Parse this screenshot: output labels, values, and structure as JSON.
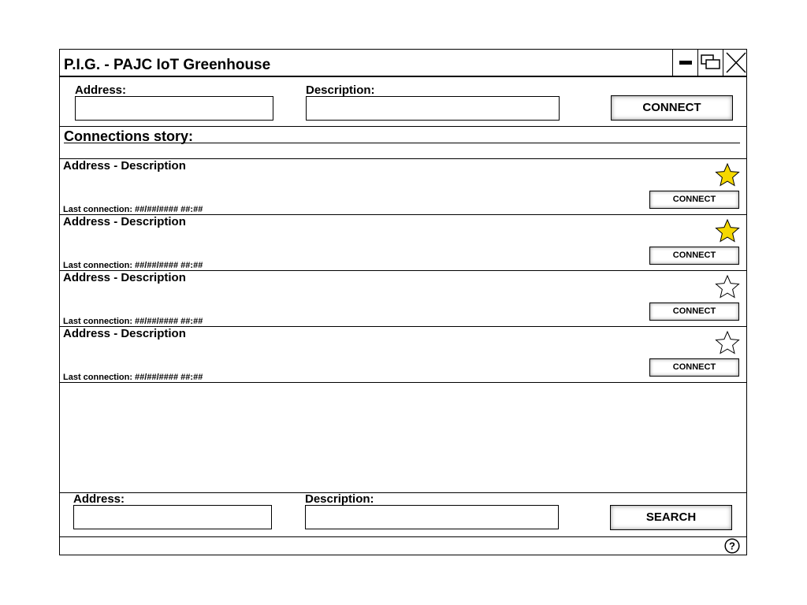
{
  "window": {
    "title": "P.I.G. - PAJC IoT Greenhouse",
    "controls": [
      "minimize-icon",
      "restore-icon",
      "close-icon"
    ]
  },
  "connect_form": {
    "address_label": "Address:",
    "address_value": "",
    "description_label": "Description:",
    "description_value": "",
    "connect_label": "CONNECT"
  },
  "story": {
    "title": "Connections story:",
    "rows": [
      {
        "title": "Address - Description",
        "last": "Last connection: ##/##/#### ##:##",
        "starred": true,
        "button": "CONNECT"
      },
      {
        "title": "Address - Description",
        "last": "Last connection: ##/##/#### ##:##",
        "starred": true,
        "button": "CONNECT"
      },
      {
        "title": "Address - Description",
        "last": "Last connection: ##/##/#### ##:##",
        "starred": false,
        "button": "CONNECT"
      },
      {
        "title": "Address - Description",
        "last": "Last connection: ##/##/#### ##:##",
        "starred": false,
        "button": "CONNECT"
      }
    ]
  },
  "search_form": {
    "address_label": "Address:",
    "address_value": "",
    "description_label": "Description:",
    "description_value": "",
    "search_label": "SEARCH"
  },
  "footer": {
    "help_icon": "help-icon"
  },
  "colors": {
    "star_filled": "#f5d800",
    "border": "#000000"
  }
}
